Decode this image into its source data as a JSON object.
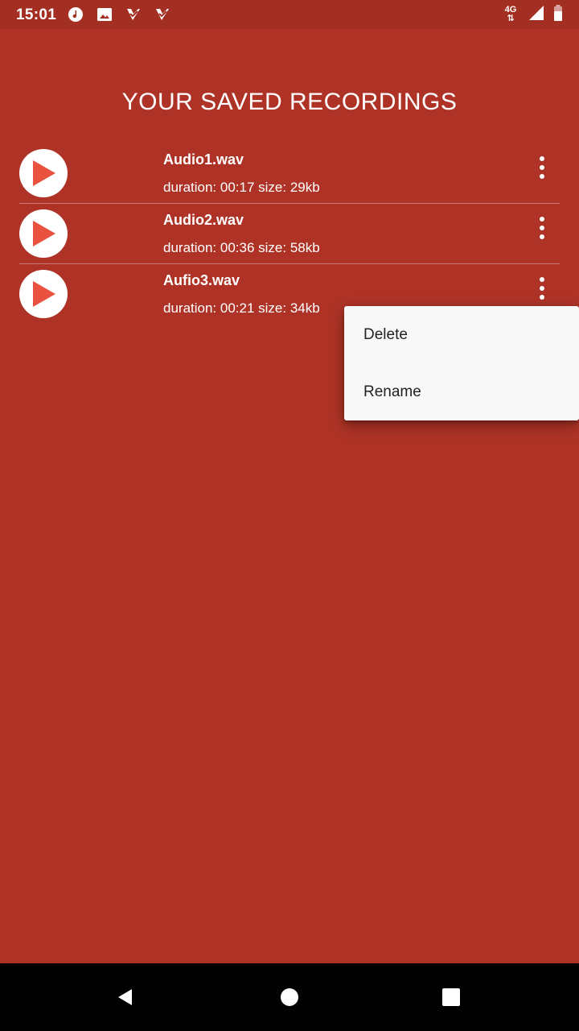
{
  "status_bar": {
    "time": "15:01",
    "network_label": "4G",
    "left_icons": [
      "music-note-icon",
      "image-icon",
      "download-check-icon",
      "download-check-icon"
    ],
    "right_icons": [
      "network-4g-icon",
      "signal-icon",
      "battery-icon"
    ]
  },
  "page": {
    "title": "YOUR SAVED RECORDINGS"
  },
  "recordings": [
    {
      "name": "Audio1.wav",
      "meta": "duration: 00:17 size: 29kb"
    },
    {
      "name": "Audio2.wav",
      "meta": "duration: 00:36 size: 58kb"
    },
    {
      "name": "Aufio3.wav",
      "meta": "duration: 00:21 size: 34kb"
    }
  ],
  "popup_menu": {
    "items": [
      "Delete",
      "Rename"
    ]
  },
  "nav_bar": {
    "icons": [
      "back-icon",
      "home-icon",
      "recents-icon"
    ]
  },
  "colors": {
    "background": "#AE3326",
    "status_bar": "#A32E22",
    "play_icon": "#E8523F",
    "menu_background": "#F8F8F8"
  }
}
